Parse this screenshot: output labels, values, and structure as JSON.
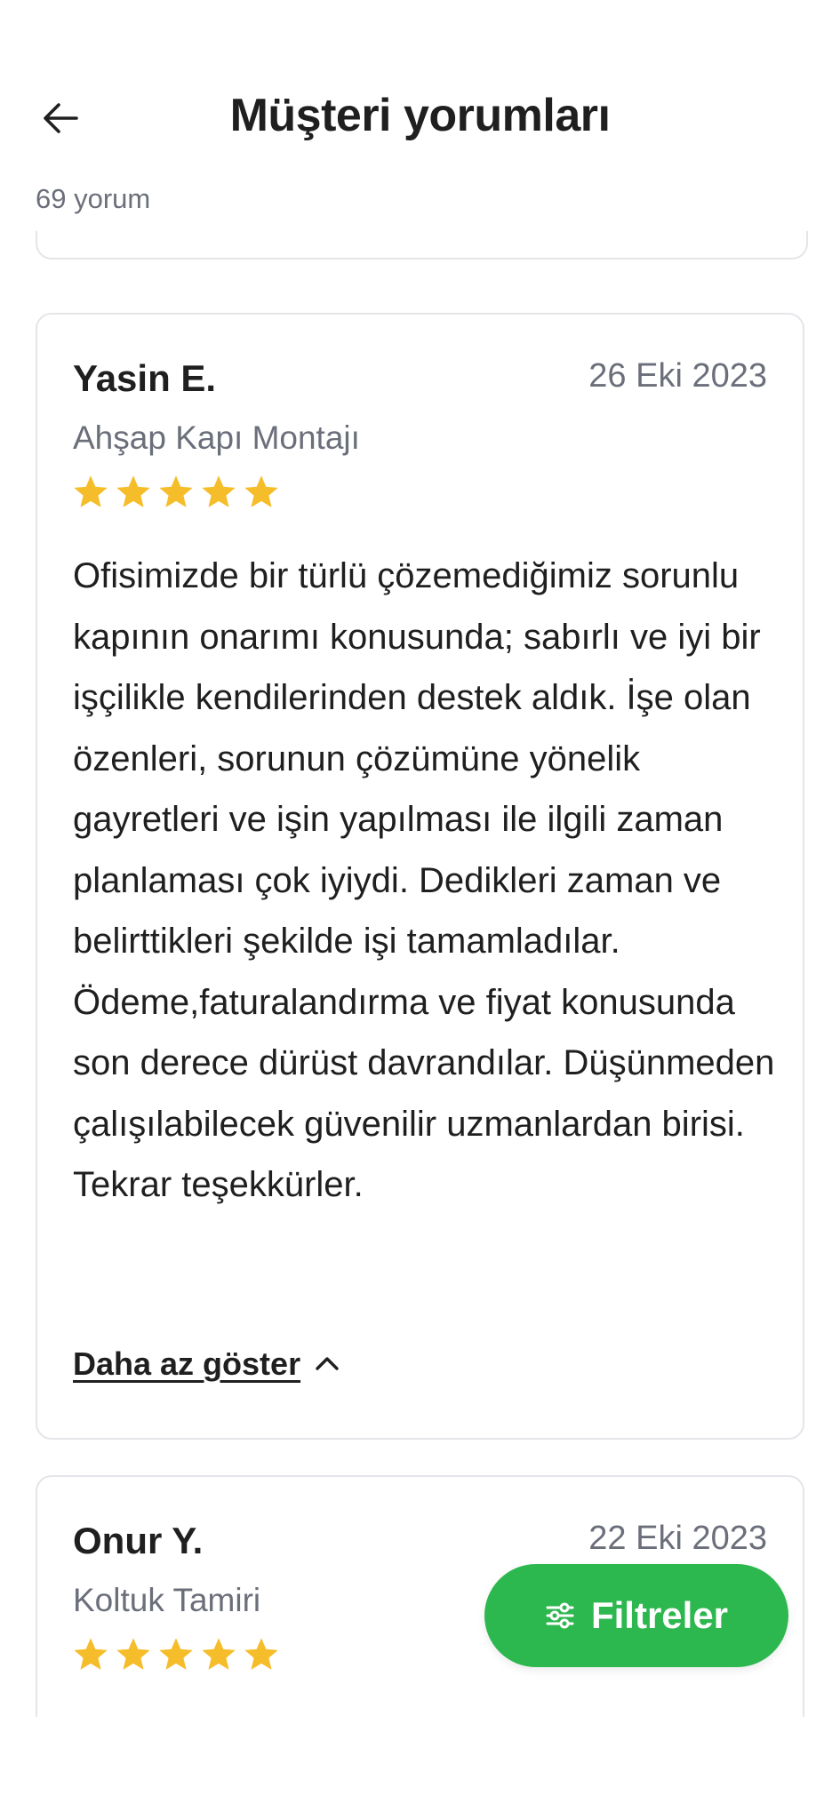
{
  "header": {
    "title": "Müşteri yorumları",
    "back_icon": "arrow-left-icon"
  },
  "summary": {
    "review_count": "69 yorum"
  },
  "reviews": [
    {
      "name": "Yasin E.",
      "date": "26 Eki 2023",
      "service": "Ahşap Kapı Montajı",
      "rating": 5,
      "text": "Ofisimizde bir türlü çözemediğimiz sorunlu kapının onarımı konusunda; sabırlı ve iyi bir işçilikle kendilerinden destek aldık. İşe olan özenleri, sorunun çözümüne yönelik gayretleri ve işin yapılması ile ilgili zaman planlaması çok iyiydi. Dedikleri zaman ve belirttikleri şekilde işi tamamladılar. Ödeme,faturalandırma ve fiyat konusunda son derece dürüst davrandılar. Düşünmeden çalışılabilecek güvenilir uzmanlardan birisi. Tekrar teşekkürler.",
      "toggle_label": "Daha az göster"
    },
    {
      "name": "Onur Y.",
      "date": "22 Eki 2023",
      "service": "Koltuk Tamiri",
      "rating": 5
    }
  ],
  "filter_button": {
    "label": "Filtreler",
    "icon": "sliders-icon"
  },
  "colors": {
    "accent_green": "#2db74f",
    "star": "#f6bd2a",
    "muted_text": "#6b6f7a",
    "card_border": "#e4e5e9"
  }
}
